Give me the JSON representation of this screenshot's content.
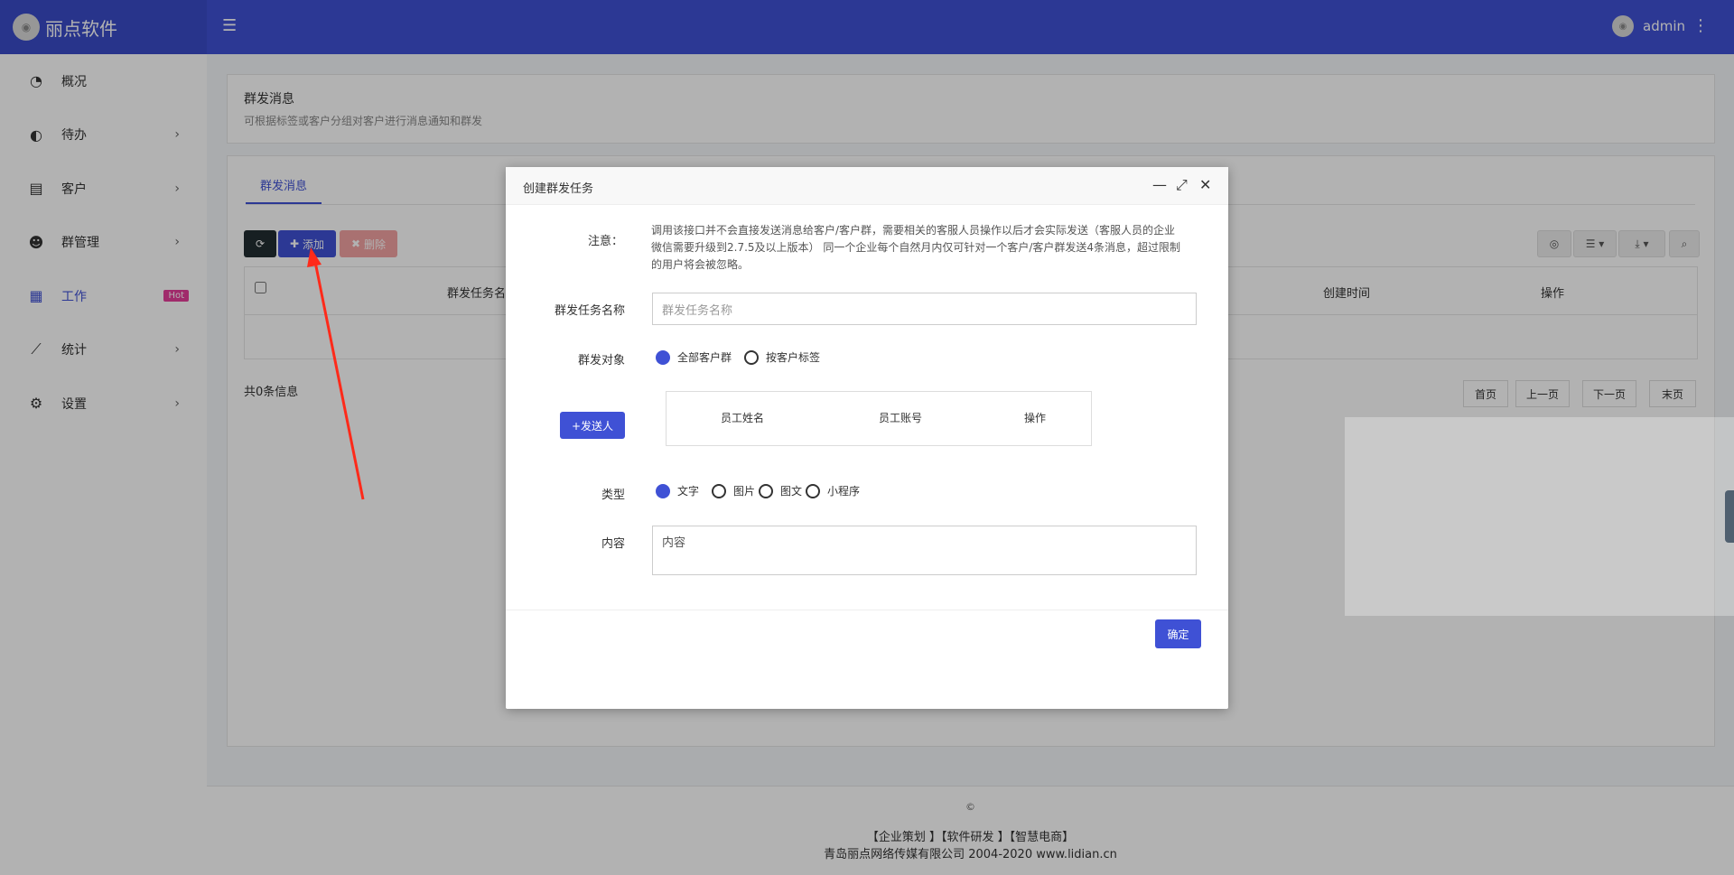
{
  "app": {
    "logo_text": "丽点软件",
    "user": "admin"
  },
  "sidebar": {
    "items": [
      {
        "label": "概况",
        "icon": "dashboard-icon"
      },
      {
        "label": "待办",
        "icon": "compass-icon"
      },
      {
        "label": "客户",
        "icon": "id-card-icon"
      },
      {
        "label": "群管理",
        "icon": "users-icon"
      },
      {
        "label": "工作",
        "icon": "grid-icon",
        "badge": "Hot"
      },
      {
        "label": "统计",
        "icon": "chart-line-icon"
      },
      {
        "label": "设置",
        "icon": "gear-icon"
      }
    ]
  },
  "page": {
    "title": "群发消息",
    "subtitle": "可根据标签或客户分组对客户进行消息通知和群发",
    "tab": "群发消息"
  },
  "toolbar": {
    "add_label": "添加",
    "delete_label": "删除"
  },
  "table": {
    "columns": [
      "群发任务名",
      "创建时间",
      "操作"
    ],
    "total_text": "共0条信息"
  },
  "pager": {
    "first": "首页",
    "prev": "上一页",
    "next": "下一页",
    "last": "末页"
  },
  "footer": {
    "copyright_symbol": "©",
    "links": "【企业策划 】【软件研发 】【智慧电商】",
    "company": "青岛丽点网络传媒有限公司 2004-2020 www.lidian.cn"
  },
  "modal": {
    "title": "创建群发任务",
    "note_label": "注意：",
    "note_text": "调用该接口并不会直接发送消息给客户/客户群，需要相关的客服人员操作以后才会实际发送（客服人员的企业微信需要升级到2.7.5及以上版本） 同一个企业每个自然月内仅可针对一个客户/客户群发送4条消息，超过限制的用户将会被忽略。",
    "task_name_label": "群发任务名称",
    "task_name_placeholder": "群发任务名称",
    "target_label": "群发对象",
    "target_options": [
      "全部客户群",
      "按客户标签"
    ],
    "sender_button": "+发送人",
    "staff_columns": [
      "员工姓名",
      "员工账号",
      "操作"
    ],
    "type_label": "类型",
    "type_options": [
      "文字",
      "图片",
      "图文",
      "小程序"
    ],
    "content_label": "内容",
    "content_placeholder": "内容",
    "confirm_button": "确定"
  },
  "colors": {
    "primary": "#3f51d5",
    "dark": "#222d32",
    "danger_light": "#f2a2a2",
    "hot_badge": "#e63e9a",
    "annotation_arrow": "#ff2a1a"
  }
}
